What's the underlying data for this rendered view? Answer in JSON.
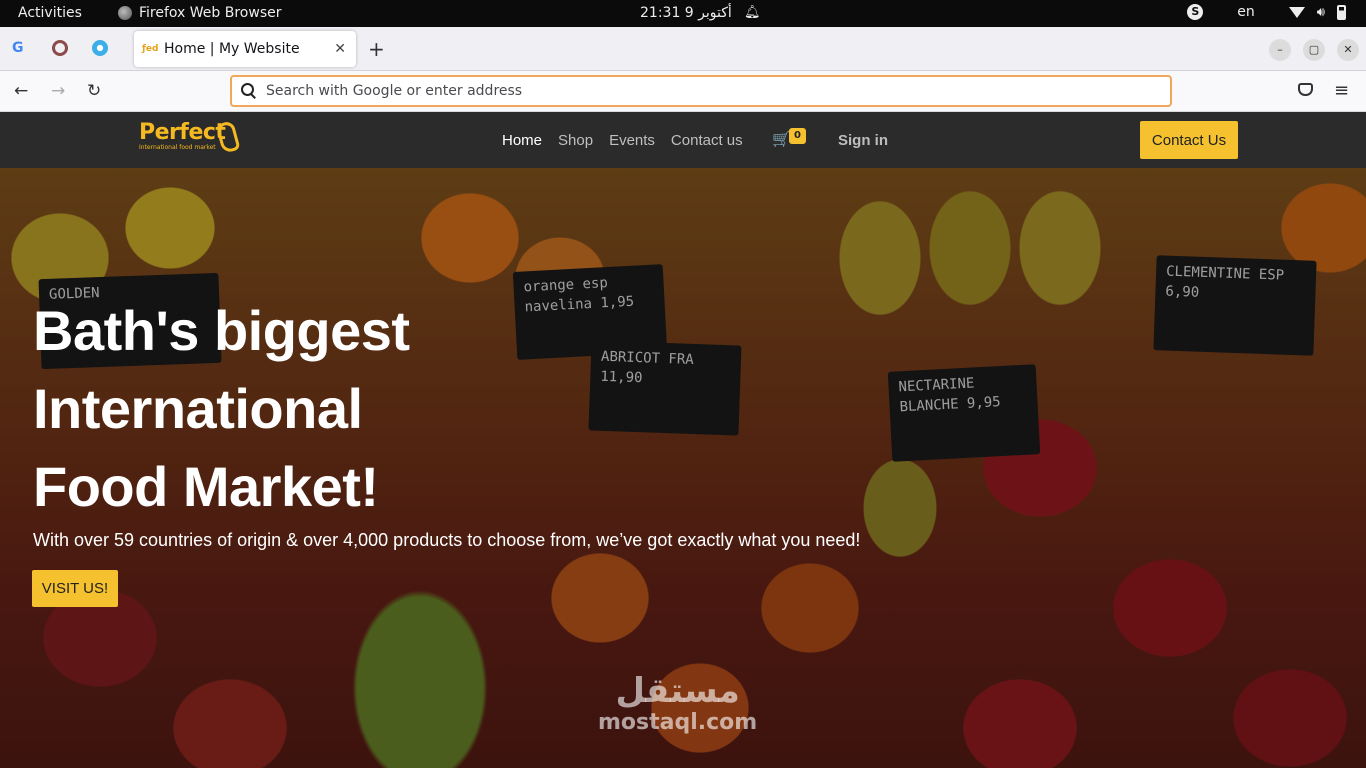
{
  "system_bar": {
    "activities": "Activities",
    "app_name": "Firefox Web Browser",
    "clock": "21:31 9 أكتوبر",
    "language": "en",
    "skype_icon": "S"
  },
  "browser": {
    "pinned_tab_google": "G",
    "tab_title": "Home | My Website",
    "tab_favicon": "ƒed",
    "tab_close": "✕",
    "new_tab": "+",
    "win_minimize": "–",
    "win_maximize": "▢",
    "win_close": "✕",
    "url_placeholder": "Search with Google or enter address",
    "back": "←",
    "forward": "→",
    "reload": "↻",
    "menu": "≡"
  },
  "site": {
    "logo_text": "Perfect",
    "logo_tagline": "International food market",
    "nav": {
      "home": "Home",
      "shop": "Shop",
      "events": "Events",
      "contact": "Contact us"
    },
    "cart_icon": "🛒",
    "cart_count": "0",
    "sign_in": "Sign in",
    "contact_button": "Contact Us",
    "hero": {
      "title": "Bath's biggest International Food Market!",
      "subtitle": "With over 59 countries of origin & over 4,000 products to choose from, we’ve got exactly what you need!",
      "button": "VISIT US!"
    },
    "signs": {
      "s1": "orange esp navelina 1,95",
      "s2": "ABRICOT FRA 11,90",
      "s3": "NECTARINE BLANCHE 9,95",
      "s4": "CLEMENTINE ESP 6,90",
      "s5": "GOLDEN"
    }
  },
  "watermark": {
    "arabic": "مستقل",
    "latin": "mostaql.com"
  },
  "colors": {
    "accent": "#f5c12e",
    "header_bg": "#2b2b2b",
    "url_focus": "#f0a65b"
  }
}
